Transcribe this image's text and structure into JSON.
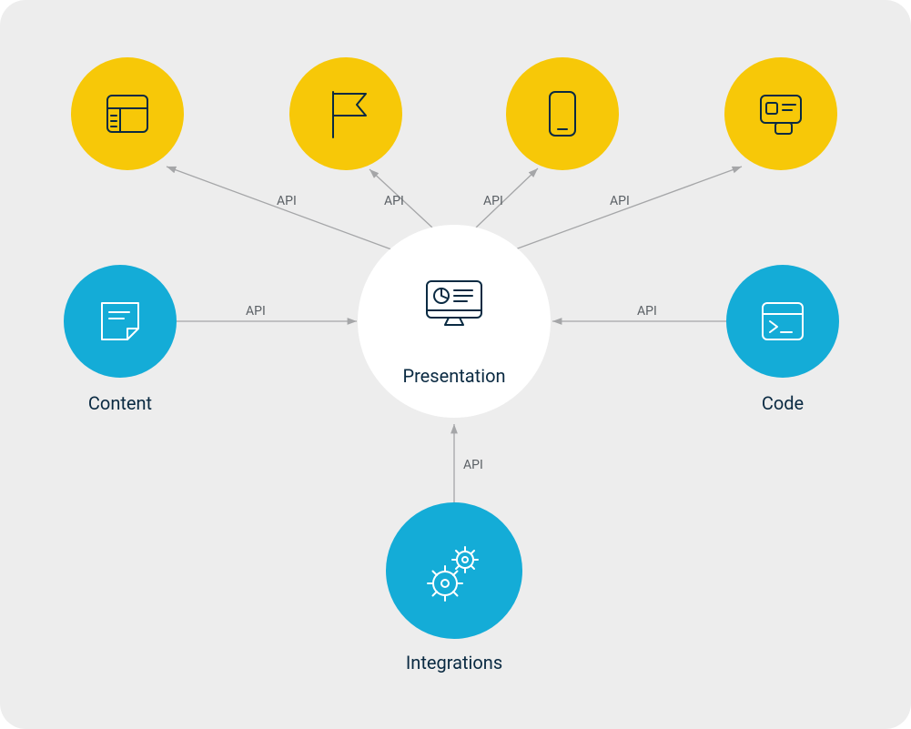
{
  "center": {
    "label": "Presentation"
  },
  "nodes": {
    "content": {
      "label": "Content"
    },
    "code": {
      "label": "Code"
    },
    "integrations": {
      "label": "Integrations"
    }
  },
  "edgeLabel": "API",
  "edges": {
    "top1": "API",
    "top2": "API",
    "top3": "API",
    "top4": "API",
    "left": "API",
    "right": "API",
    "bottom": "API"
  }
}
